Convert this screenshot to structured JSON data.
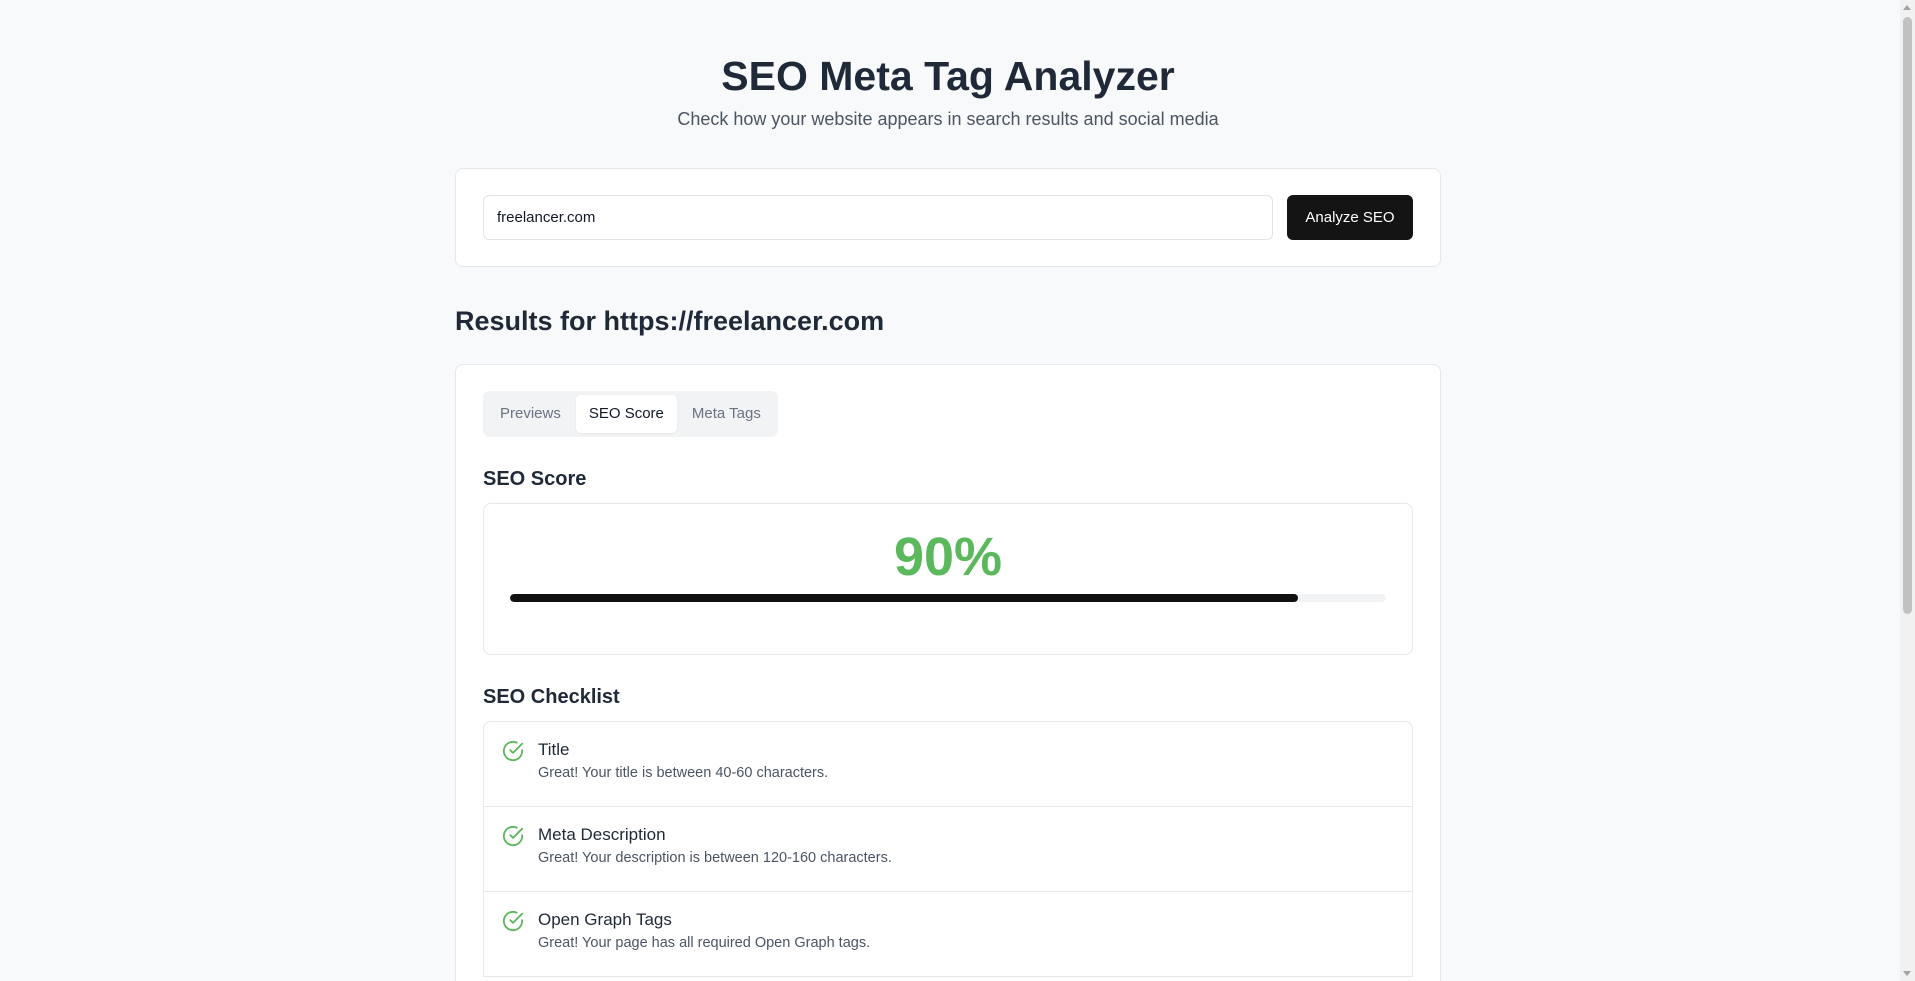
{
  "header": {
    "title": "SEO Meta Tag Analyzer",
    "subtitle": "Check how your website appears in search results and social media"
  },
  "search": {
    "value": "freelancer.com",
    "button_label": "Analyze SEO"
  },
  "results": {
    "title": "Results for https://freelancer.com"
  },
  "tabs": [
    {
      "label": "Previews",
      "active": false
    },
    {
      "label": "SEO Score",
      "active": true
    },
    {
      "label": "Meta Tags",
      "active": false
    }
  ],
  "score": {
    "section_title": "SEO Score",
    "value_text": "90%",
    "percent": 90,
    "color": "#5cb85c"
  },
  "checklist": {
    "section_title": "SEO Checklist",
    "items": [
      {
        "title": "Title",
        "description": "Great! Your title is between 40-60 characters.",
        "icon": "check-circle-icon"
      },
      {
        "title": "Meta Description",
        "description": "Great! Your description is between 120-160 characters.",
        "icon": "check-circle-icon"
      },
      {
        "title": "Open Graph Tags",
        "description": "Great! Your page has all required Open Graph tags.",
        "icon": "check-circle-icon"
      }
    ]
  }
}
